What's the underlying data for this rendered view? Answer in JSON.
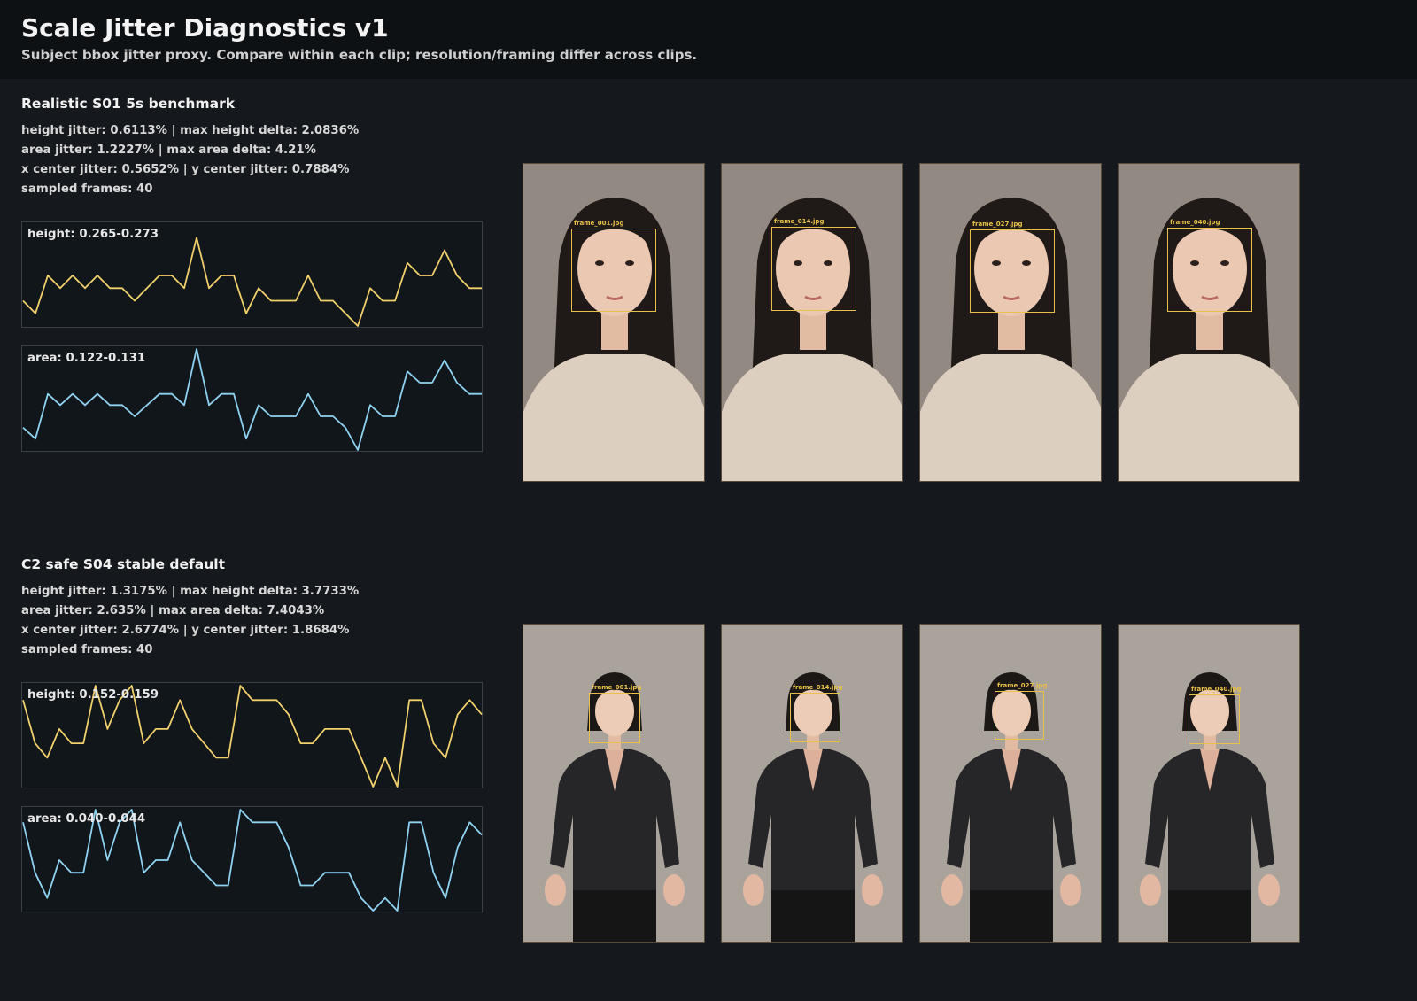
{
  "header": {
    "title": "Scale Jitter Diagnostics v1",
    "subtitle": "Subject bbox jitter proxy. Compare within each clip; resolution/framing differ across clips."
  },
  "colors": {
    "height_series": "#f2d06b",
    "area_series": "#8fd3f2",
    "bbox": "#e7c14a"
  },
  "clips": [
    {
      "title": "Realistic S01 5s benchmark",
      "stats": [
        "height jitter: 0.6113% | max height delta: 2.0836%",
        "area jitter: 1.2227% | max area delta: 4.21%",
        "x center jitter: 0.5652% | y center jitter: 0.7884%",
        "sampled frames: 40"
      ],
      "height_label": "height: 0.265-0.273",
      "area_label": "area: 0.122-0.131",
      "framing": "portrait",
      "frames": [
        {
          "label": "frame_001.jpg"
        },
        {
          "label": "frame_014.jpg"
        },
        {
          "label": "frame_027.jpg"
        },
        {
          "label": "frame_040.jpg"
        }
      ]
    },
    {
      "title": "C2 safe S04 stable default",
      "stats": [
        "height jitter: 1.3175% | max height delta: 3.7733%",
        "area jitter: 2.635% | max area delta: 7.4043%",
        "x center jitter: 2.6774% | y center jitter: 1.8684%",
        "sampled frames: 40"
      ],
      "height_label": "height: 0.152-0.159",
      "area_label": "area: 0.040-0.044",
      "framing": "full-body",
      "frames": [
        {
          "label": "frame_001.jpg"
        },
        {
          "label": "frame_014.jpg"
        },
        {
          "label": "frame_027.jpg"
        },
        {
          "label": "frame_040.jpg"
        }
      ]
    }
  ],
  "chart_data": [
    {
      "type": "line",
      "title": "height: 0.265-0.273",
      "series": [
        {
          "values": [
            0.267,
            0.266,
            0.269,
            0.268,
            0.269,
            0.268,
            0.269,
            0.268,
            0.268,
            0.267,
            0.268,
            0.269,
            0.269,
            0.268,
            0.272,
            0.268,
            0.269,
            0.269,
            0.266,
            0.268,
            0.267,
            0.267,
            0.267,
            0.269,
            0.267,
            0.267,
            0.266,
            0.265,
            0.268,
            0.267,
            0.267,
            0.27,
            0.269,
            0.269,
            0.271,
            0.269,
            0.268,
            0.268
          ]
        }
      ],
      "ylim": [
        0.265,
        0.273
      ]
    },
    {
      "type": "line",
      "title": "area: 0.122-0.131",
      "series": [
        {
          "values": [
            0.124,
            0.123,
            0.127,
            0.126,
            0.127,
            0.126,
            0.127,
            0.126,
            0.126,
            0.125,
            0.126,
            0.127,
            0.127,
            0.126,
            0.131,
            0.126,
            0.127,
            0.127,
            0.123,
            0.126,
            0.125,
            0.125,
            0.125,
            0.127,
            0.125,
            0.125,
            0.124,
            0.122,
            0.126,
            0.125,
            0.125,
            0.129,
            0.128,
            0.128,
            0.13,
            0.128,
            0.127,
            0.127
          ]
        }
      ],
      "ylim": [
        0.122,
        0.131
      ]
    },
    {
      "type": "line",
      "title": "height: 0.152-0.159",
      "series": [
        {
          "values": [
            0.158,
            0.155,
            0.154,
            0.156,
            0.155,
            0.155,
            0.159,
            0.156,
            0.158,
            0.159,
            0.155,
            0.156,
            0.156,
            0.158,
            0.156,
            0.155,
            0.154,
            0.154,
            0.159,
            0.158,
            0.158,
            0.158,
            0.157,
            0.155,
            0.155,
            0.156,
            0.156,
            0.156,
            0.154,
            0.152,
            0.154,
            0.152,
            0.158,
            0.158,
            0.155,
            0.154,
            0.157,
            0.158,
            0.157
          ]
        }
      ],
      "ylim": [
        0.152,
        0.159
      ]
    },
    {
      "type": "line",
      "title": "area: 0.040-0.044",
      "series": [
        {
          "values": [
            0.0435,
            0.0415,
            0.0405,
            0.042,
            0.0415,
            0.0415,
            0.044,
            0.042,
            0.0435,
            0.044,
            0.0415,
            0.042,
            0.042,
            0.0435,
            0.042,
            0.0415,
            0.041,
            0.041,
            0.044,
            0.0435,
            0.0435,
            0.0435,
            0.0425,
            0.041,
            0.041,
            0.0415,
            0.0415,
            0.0415,
            0.0405,
            0.04,
            0.0405,
            0.04,
            0.0435,
            0.0435,
            0.0415,
            0.0405,
            0.0425,
            0.0435,
            0.043
          ]
        }
      ],
      "ylim": [
        0.04,
        0.044
      ]
    }
  ]
}
